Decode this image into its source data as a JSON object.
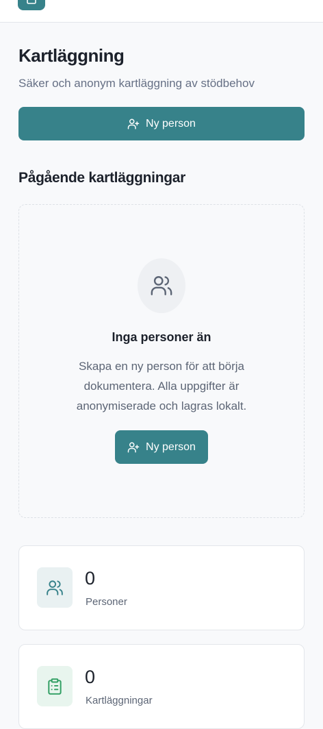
{
  "header": {
    "logo_icon": "app-logo-icon"
  },
  "page": {
    "title": "Kartläggning",
    "subtitle": "Säker och anonym kartläggning av stödbehov"
  },
  "actions": {
    "new_person_label": "Ny person",
    "new_person_icon": "user-plus-icon"
  },
  "ongoing": {
    "section_title": "Pågående kartläggningar",
    "empty": {
      "icon": "users-icon",
      "title": "Inga personer än",
      "description": "Skapa en ny person för att börja dokumentera. Alla uppgifter är anonymiserade och lagras lokalt.",
      "button_label": "Ny person"
    }
  },
  "stats": [
    {
      "value": "0",
      "label": "Personer",
      "icon": "users-icon",
      "icon_color": "#37828a"
    },
    {
      "value": "0",
      "label": "Kartläggningar",
      "icon": "clipboard-list-icon",
      "icon_color": "#2f9e62"
    }
  ],
  "colors": {
    "accent": "#37828a",
    "success": "#2f9e62",
    "background": "#f8f9fb"
  }
}
